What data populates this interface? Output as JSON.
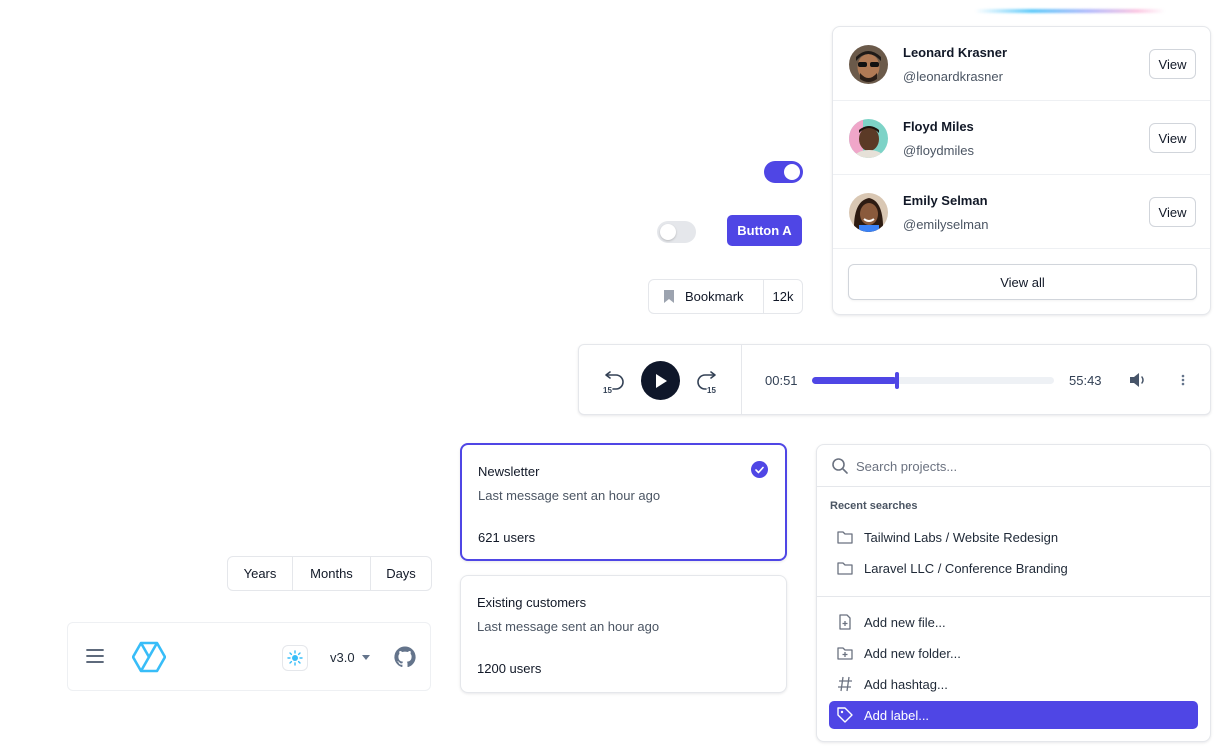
{
  "people": [
    {
      "name": "Leonard Krasner",
      "handle": "@leonardkrasner",
      "action": "View"
    },
    {
      "name": "Floyd Miles",
      "handle": "@floydmiles",
      "action": "View"
    },
    {
      "name": "Emily Selman",
      "handle": "@emilyselman",
      "action": "View"
    }
  ],
  "people_view_all": "View all",
  "button_a": "Button A",
  "toggles": {
    "primary_on": true,
    "secondary_on": false
  },
  "bookmark": {
    "label": "Bookmark",
    "count": "12k"
  },
  "player": {
    "current_time": "00:51",
    "duration": "55:43",
    "progress": 0.35,
    "skip_seconds": "15"
  },
  "radio_cards": [
    {
      "title": "Newsletter",
      "subtitle": "Last message sent an hour ago",
      "users": "621 users",
      "selected": true
    },
    {
      "title": "Existing customers",
      "subtitle": "Last message sent an hour ago",
      "users": "1200 users",
      "selected": false
    }
  ],
  "palette": {
    "search_placeholder": "Search projects...",
    "recent_title": "Recent searches",
    "recent": [
      "Tailwind Labs / Website Redesign",
      "Laravel LLC / Conference Branding"
    ],
    "actions": [
      "Add new file...",
      "Add new folder...",
      "Add hashtag...",
      "Add label..."
    ],
    "active_action": "Add label..."
  },
  "segmented": [
    "Years",
    "Months",
    "Days"
  ],
  "navbar": {
    "version": "v3.0"
  },
  "colors": {
    "accent": "#4f46e5",
    "dark": "#0f172a",
    "logo": "#38bdf8"
  }
}
